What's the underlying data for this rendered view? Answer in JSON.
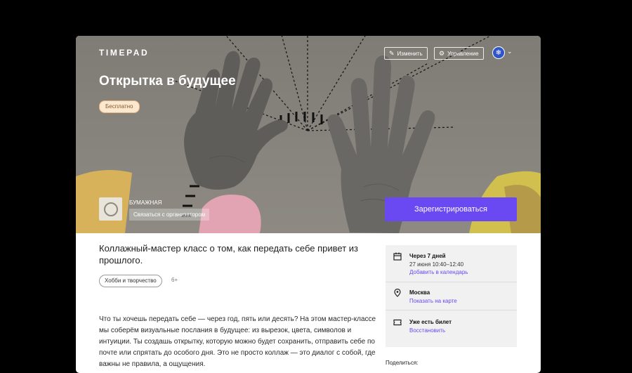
{
  "header": {
    "logo": "TIMEPAD",
    "edit_label": "Изменить",
    "manage_label": "Управление"
  },
  "event": {
    "title": "Открытка в будущее",
    "price_badge": "Бесплатно",
    "organizer_name": "БУМАЖНАЯ",
    "contact_label": "Связаться с организатором",
    "register_label": "Зарегистрироваться",
    "lead": "Коллажный-мастер класс о том, как передать себе привет из прошлого.",
    "category_tag": "Хобби и творчество",
    "age_limit": "6+",
    "description": "Что ты хочешь передать себе — через год, пять или десять? На этом мастер-классе мы соберём визуальные послания в будущее: из вырезок, цвета, символов и интуиции. Ты создашь открытку, которую можно будет сохранить, отправить себе по почте или спрятать до особого дня. Это не просто коллаж — это диалог с собой, где важны не правила, а ощущения."
  },
  "info_panel": {
    "date_title": "Через 7 дней",
    "date_value": "27 июня 10:40–12:40",
    "date_link": "Добавить в календарь",
    "place_title": "Москва",
    "place_link": "Показать на карте",
    "ticket_title": "Уже есть билет",
    "ticket_link": "Восстановить"
  },
  "share_label": "Поделиться:",
  "colors": {
    "accent": "#6a48f2",
    "hero_bg": "#86837d",
    "badge_bg": "#fbe8cf"
  }
}
